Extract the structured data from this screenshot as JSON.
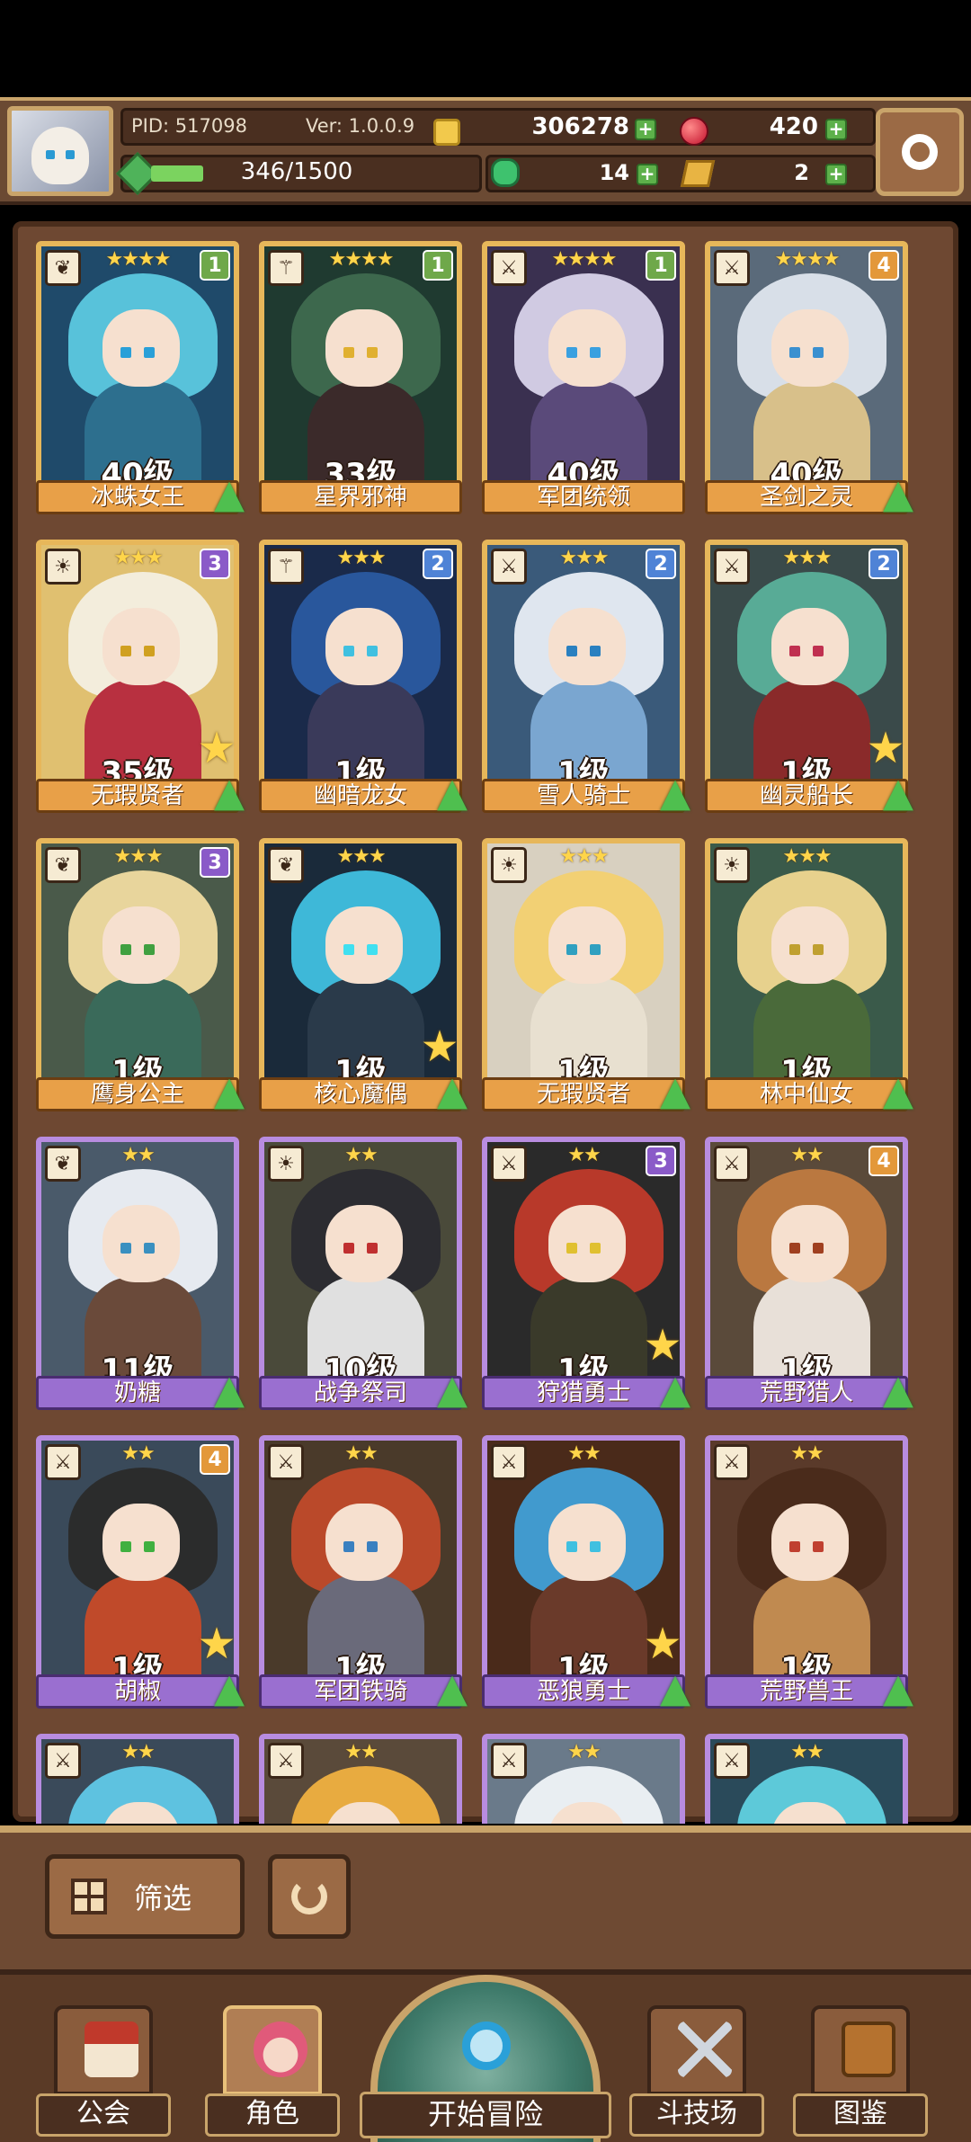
{
  "header": {
    "pid": "PID: 517098",
    "version": "Ver: 1.0.0.9",
    "gold": "306278",
    "gems": "420",
    "exp": "346/1500",
    "exp_progress": 0.23,
    "clover": "14",
    "tickets": "2",
    "plus": "+"
  },
  "cards": [
    {
      "name": "冰蛛女王",
      "level": "40级",
      "stars": "★★★★",
      "rank": "1",
      "frame": "gold",
      "star_badge": false,
      "up": true,
      "class_icon": "leaf-icon",
      "art": {
        "hair": "#5cc8e0",
        "body": "#2d6f8e",
        "bg": "#1f4a6a",
        "eye": "#2aa0d8"
      }
    },
    {
      "name": "星界邪神",
      "level": "33级",
      "stars": "★★★★",
      "rank": "1",
      "frame": "gold",
      "star_badge": false,
      "up": false,
      "class_icon": "staff-icon",
      "art": {
        "hair": "#3f6a4f",
        "body": "#3b2a2a",
        "bg": "#1f3a30",
        "eye": "#e0b030"
      }
    },
    {
      "name": "军团统领",
      "level": "40级",
      "stars": "★★★★",
      "rank": "1",
      "frame": "gold",
      "star_badge": false,
      "up": false,
      "class_icon": "sword-icon",
      "art": {
        "hair": "#d8d3ea",
        "body": "#5a4a7a",
        "bg": "#3a3050",
        "eye": "#3aa0e0"
      }
    },
    {
      "name": "圣剑之灵",
      "level": "40级",
      "stars": "★★★★",
      "rank": "4",
      "frame": "gold",
      "star_badge": false,
      "up": true,
      "class_icon": "sword-icon",
      "art": {
        "hair": "#dfe6ee",
        "body": "#d8c08a",
        "bg": "#5a6a7a",
        "eye": "#3a90d0"
      }
    },
    {
      "name": "无瑕贤者",
      "level": "35级",
      "stars": "★★★",
      "rank": "3",
      "frame": "gold",
      "star_badge": true,
      "up": true,
      "class_icon": "sun-icon",
      "art": {
        "hair": "#f3efe2",
        "body": "#b83040",
        "bg": "#e0c070",
        "eye": "#d0a020"
      }
    },
    {
      "name": "幽暗龙女",
      "level": "1级",
      "stars": "★★★",
      "rank": "2",
      "frame": "gold",
      "star_badge": false,
      "up": true,
      "class_icon": "staff-icon",
      "art": {
        "hair": "#2a5aa0",
        "body": "#3a3a5a",
        "bg": "#1a2a4a",
        "eye": "#40c0e0"
      }
    },
    {
      "name": "雪人骑士",
      "level": "1级",
      "stars": "★★★",
      "rank": "2",
      "frame": "gold",
      "star_badge": false,
      "up": true,
      "class_icon": "sword-icon",
      "art": {
        "hair": "#e8eef6",
        "body": "#7aa6d0",
        "bg": "#3a5a7a",
        "eye": "#2a80c0"
      }
    },
    {
      "name": "幽灵船长",
      "level": "1级",
      "stars": "★★★",
      "rank": "2",
      "frame": "gold",
      "star_badge": true,
      "up": true,
      "class_icon": "sword-icon",
      "art": {
        "hair": "#5ab09a",
        "body": "#8a2a2a",
        "bg": "#3a4a4a",
        "eye": "#c03050"
      }
    },
    {
      "name": "鹰身公主",
      "level": "1级",
      "stars": "★★★",
      "rank": "3",
      "frame": "gold",
      "star_badge": false,
      "up": true,
      "class_icon": "leaf-icon",
      "art": {
        "hair": "#f0dca0",
        "body": "#3a6a5a",
        "bg": "#4a5a4a",
        "eye": "#40a040"
      }
    },
    {
      "name": "核心魔偶",
      "level": "1级",
      "stars": "★★★",
      "rank": "",
      "frame": "gold",
      "star_badge": true,
      "up": true,
      "class_icon": "leaf-icon",
      "art": {
        "hair": "#40c0e0",
        "body": "#2a3a4a",
        "bg": "#1a2a3a",
        "eye": "#40e0f0"
      }
    },
    {
      "name": "无瑕贤者",
      "level": "1级",
      "stars": "★★★",
      "rank": "",
      "frame": "gold",
      "star_badge": false,
      "up": true,
      "class_icon": "sun-icon",
      "art": {
        "hair": "#f3d070",
        "body": "#e8e0d0",
        "bg": "#d8d0c0",
        "eye": "#30a0c0"
      }
    },
    {
      "name": "林中仙女",
      "level": "1级",
      "stars": "★★★",
      "rank": "",
      "frame": "gold",
      "star_badge": false,
      "up": true,
      "class_icon": "sun-icon",
      "art": {
        "hair": "#f0d890",
        "body": "#4a6a3a",
        "bg": "#3a5a4a",
        "eye": "#c0a030"
      }
    },
    {
      "name": "奶糖",
      "level": "11级",
      "stars": "★★",
      "rank": "",
      "frame": "purple",
      "star_badge": false,
      "up": true,
      "class_icon": "leaf-icon",
      "art": {
        "hair": "#eef2f8",
        "body": "#6a4a3a",
        "bg": "#4a5a6a",
        "eye": "#3a90c0"
      }
    },
    {
      "name": "战争祭司",
      "level": "10级",
      "stars": "★★",
      "rank": "",
      "frame": "purple",
      "star_badge": false,
      "up": true,
      "class_icon": "sun-icon",
      "art": {
        "hair": "#2a2a30",
        "body": "#e0e0e0",
        "bg": "#4a4a3a",
        "eye": "#c03030"
      }
    },
    {
      "name": "狩猎勇士",
      "level": "1级",
      "stars": "★★",
      "rank": "3",
      "frame": "purple",
      "star_badge": true,
      "up": true,
      "class_icon": "sword-icon",
      "art": {
        "hair": "#c03a2a",
        "body": "#3a3a2a",
        "bg": "#2a2a2a",
        "eye": "#e0c030"
      }
    },
    {
      "name": "荒野猎人",
      "level": "1级",
      "stars": "★★",
      "rank": "4",
      "frame": "purple",
      "star_badge": false,
      "up": true,
      "class_icon": "sword-icon",
      "art": {
        "hair": "#c07a40",
        "body": "#e8e0d8",
        "bg": "#5a4a3a",
        "eye": "#a04020"
      }
    },
    {
      "name": "胡椒",
      "level": "1级",
      "stars": "★★",
      "rank": "4",
      "frame": "purple",
      "star_badge": true,
      "up": true,
      "class_icon": "sword-icon",
      "art": {
        "hair": "#2a2a2a",
        "body": "#c04a2a",
        "bg": "#3a4a5a",
        "eye": "#40b040"
      }
    },
    {
      "name": "军团铁骑",
      "level": "1级",
      "stars": "★★",
      "rank": "",
      "frame": "purple",
      "star_badge": false,
      "up": true,
      "class_icon": "sword-icon",
      "art": {
        "hair": "#c04a2a",
        "body": "#6a6a7a",
        "bg": "#4a3a2a",
        "eye": "#3a80c0"
      }
    },
    {
      "name": "恶狼勇士",
      "level": "1级",
      "stars": "★★",
      "rank": "",
      "frame": "purple",
      "star_badge": true,
      "up": true,
      "class_icon": "sword-icon",
      "art": {
        "hair": "#40a0d8",
        "body": "#6a3a2a",
        "bg": "#4a2a1a",
        "eye": "#40c0e0"
      }
    },
    {
      "name": "荒野兽王",
      "level": "1级",
      "stars": "★★",
      "rank": "",
      "frame": "purple",
      "star_badge": false,
      "up": true,
      "class_icon": "sword-icon",
      "art": {
        "hair": "#4a2a1a",
        "body": "#c08a50",
        "bg": "#5a3a2a",
        "eye": "#c04030"
      }
    },
    {
      "name": "",
      "level": "",
      "stars": "★★",
      "rank": "",
      "frame": "purple",
      "star_badge": false,
      "up": false,
      "class_icon": "sword-icon",
      "art": {
        "hair": "#60c8e8",
        "body": "#3a5a7a",
        "bg": "#3a4a5a",
        "eye": "#2a80c0"
      }
    },
    {
      "name": "",
      "level": "",
      "stars": "★★",
      "rank": "",
      "frame": "purple",
      "star_badge": false,
      "up": false,
      "class_icon": "sword-icon",
      "art": {
        "hair": "#f0b040",
        "body": "#6a4a2a",
        "bg": "#5a4a3a",
        "eye": "#c08020"
      }
    },
    {
      "name": "",
      "level": "",
      "stars": "★★",
      "rank": "",
      "frame": "purple",
      "star_badge": false,
      "up": false,
      "class_icon": "sword-icon",
      "art": {
        "hair": "#f0f4f8",
        "body": "#8aa0b8",
        "bg": "#6a7a8a",
        "eye": "#3a90c0"
      }
    },
    {
      "name": "",
      "level": "",
      "stars": "★★",
      "rank": "",
      "frame": "purple",
      "star_badge": false,
      "up": false,
      "class_icon": "sword-icon",
      "art": {
        "hair": "#60d0e0",
        "body": "#3a6a7a",
        "bg": "#2a4a5a",
        "eye": "#3aa0d0"
      }
    }
  ],
  "filter": {
    "label": "筛选"
  },
  "nav": {
    "guild": "公会",
    "characters": "角色",
    "adventure": "开始冒险",
    "arena": "斗技场",
    "codex": "图鉴"
  },
  "colors": {
    "gold_frame": "#e7b75a",
    "purple_frame": "#b88ce0",
    "panel_brown": "#6e4832",
    "upgrade_green": "#4fbf4f",
    "star_yellow": "#ffd54a"
  }
}
